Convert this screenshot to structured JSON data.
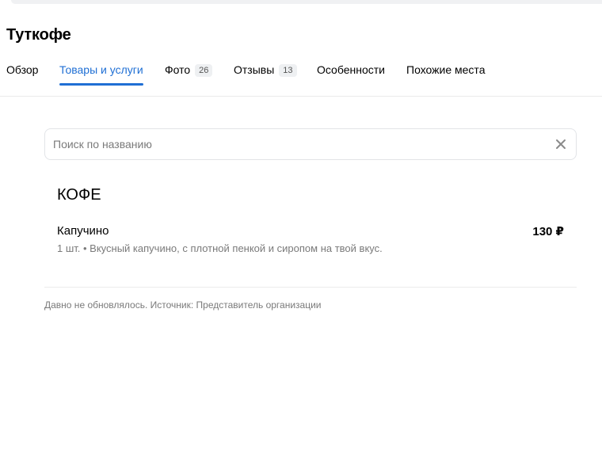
{
  "org": {
    "title": "Туткофе"
  },
  "tabs": [
    {
      "label": "Обзор"
    },
    {
      "label": "Товары и услуги",
      "active": true
    },
    {
      "label": "Фото",
      "count": "26"
    },
    {
      "label": "Отзывы",
      "count": "13"
    },
    {
      "label": "Особенности"
    },
    {
      "label": "Похожие места"
    }
  ],
  "search": {
    "placeholder": "Поиск по названию",
    "value": ""
  },
  "menu": {
    "category": "КОФЕ",
    "items": [
      {
        "name": "Капучино",
        "price": "130 ₽",
        "description": "1 шт. • Вкусный капучино, с плотной пенкой и сиропом на твой вкус."
      }
    ]
  },
  "footer": {
    "note": "Давно не обновлялось. Источник: Представитель организации"
  },
  "colors": {
    "accent": "#1f6fd4",
    "muted_text": "#7a7a7a",
    "divider": "#ebebeb"
  },
  "icons": {
    "clear": "close-icon"
  }
}
